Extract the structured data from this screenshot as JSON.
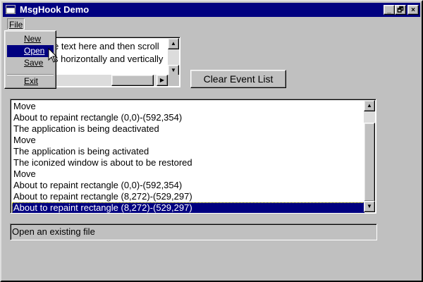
{
  "window": {
    "title": "MsgHook Demo",
    "controls": {
      "minimize": "_",
      "maximize": "🗗",
      "close": "×"
    }
  },
  "menubar": {
    "file": "File"
  },
  "file_menu": {
    "items": [
      "New",
      "Open",
      "Save",
      "Exit"
    ],
    "active": "Open"
  },
  "textbox": {
    "lines": [
      "Type some text here and then scroll",
      "this box horizontally and vertically."
    ],
    "visible_lines": [
      "e text here and then scroll",
      "s horizontally and vertically"
    ]
  },
  "clear_button": {
    "label": "Clear Event List"
  },
  "event_list": {
    "items": [
      "Move",
      "About to repaint rectangle (0,0)-(592,354)",
      "The application is being deactivated",
      "Move",
      "The application is being activated",
      "The iconized window is about to be restored",
      "Move",
      "About to repaint rectangle (0,0)-(592,354)",
      "About to repaint rectangle (8,272)-(529,297)",
      "About to repaint rectangle (8,272)-(529,297)"
    ],
    "selected_index": 9
  },
  "status": {
    "text": "Open an existing file"
  },
  "icons": {
    "window": "window-app-icon",
    "scroll_up": "▲",
    "scroll_down": "▼",
    "scroll_right": "▶"
  },
  "colors": {
    "titlebar": "#000080",
    "face": "#c0c0c0",
    "selection": "#000080"
  }
}
